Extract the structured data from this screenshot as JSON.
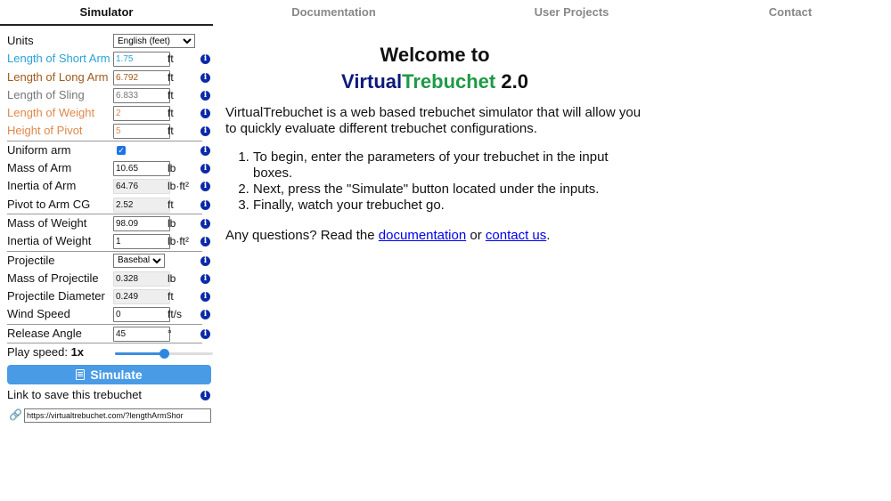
{
  "nav": {
    "tabs": [
      {
        "label": "Simulator",
        "active": true
      },
      {
        "label": "Documentation",
        "active": false
      },
      {
        "label": "User Projects",
        "active": false
      },
      {
        "label": "Contact",
        "active": false
      }
    ]
  },
  "sidebar": {
    "units": {
      "label": "Units",
      "value": "English (feet)"
    },
    "short_arm": {
      "label": "Length of Short Arm",
      "value": "1.75",
      "unit": "ft"
    },
    "long_arm": {
      "label": "Length of Long Arm",
      "value": "6.792",
      "unit": "ft"
    },
    "sling": {
      "label": "Length of Sling",
      "value": "6.833",
      "unit": "ft"
    },
    "weight_len": {
      "label": "Length of Weight",
      "value": "2",
      "unit": "ft"
    },
    "pivot": {
      "label": "Height of Pivot",
      "value": "5",
      "unit": "ft"
    },
    "uniform_arm": {
      "label": "Uniform arm",
      "checked": true
    },
    "mass_arm": {
      "label": "Mass of Arm",
      "value": "10.65",
      "unit": "lb"
    },
    "inertia_arm": {
      "label": "Inertia of Arm",
      "value": "64.76",
      "unit": "lb·ft²"
    },
    "pivot_cg": {
      "label": "Pivot to Arm CG",
      "value": "2.52",
      "unit": "ft"
    },
    "mass_weight": {
      "label": "Mass of Weight",
      "value": "98.09",
      "unit": "lb"
    },
    "inertia_weight": {
      "label": "Inertia of Weight",
      "value": "1",
      "unit": "lb·ft²"
    },
    "projectile": {
      "label": "Projectile",
      "value": "Baseball"
    },
    "mass_proj": {
      "label": "Mass of Projectile",
      "value": "0.328",
      "unit": "lb"
    },
    "proj_diam": {
      "label": "Projectile Diameter",
      "value": "0.249",
      "unit": "ft"
    },
    "wind": {
      "label": "Wind Speed",
      "value": "0",
      "unit": "ft/s"
    },
    "release": {
      "label": "Release Angle",
      "value": "45",
      "unit": "°"
    },
    "play_speed": {
      "label": "Play speed:",
      "value": "1x",
      "slider_fraction": 0.5
    },
    "simulate_label": "Simulate",
    "save_link_label": "Link to save this trebuchet",
    "save_link_value": "https://virtualtrebuchet.com/?lengthArmShor"
  },
  "main": {
    "title_line1": "Welcome to",
    "title_part_a": "Virtual",
    "title_part_b": "Trebuchet",
    "title_part_c": " 2.0",
    "intro": "VirtualTrebuchet is a web based trebuchet simulator that will allow you to quickly evaluate different trebuchet configurations.",
    "steps": [
      "To begin, enter the parameters of your trebuchet in the input boxes.",
      "Next, press the \"Simulate\" button located under the inputs.",
      "Finally, watch your trebuchet go."
    ],
    "question_prefix": "Any questions? Read the ",
    "doc_link": "documentation",
    "question_mid": " or ",
    "contact_link": "contact us",
    "question_suffix": "."
  },
  "colors": {
    "short_arm": "#2aa3d8",
    "long_arm": "#a05a1c",
    "sling": "#777777",
    "weight": "#e0884a",
    "virtual": "#0d1a7a",
    "trebuchet": "#1f9a45",
    "button": "#4a9be6",
    "info_icon": "#0b2aa8"
  }
}
